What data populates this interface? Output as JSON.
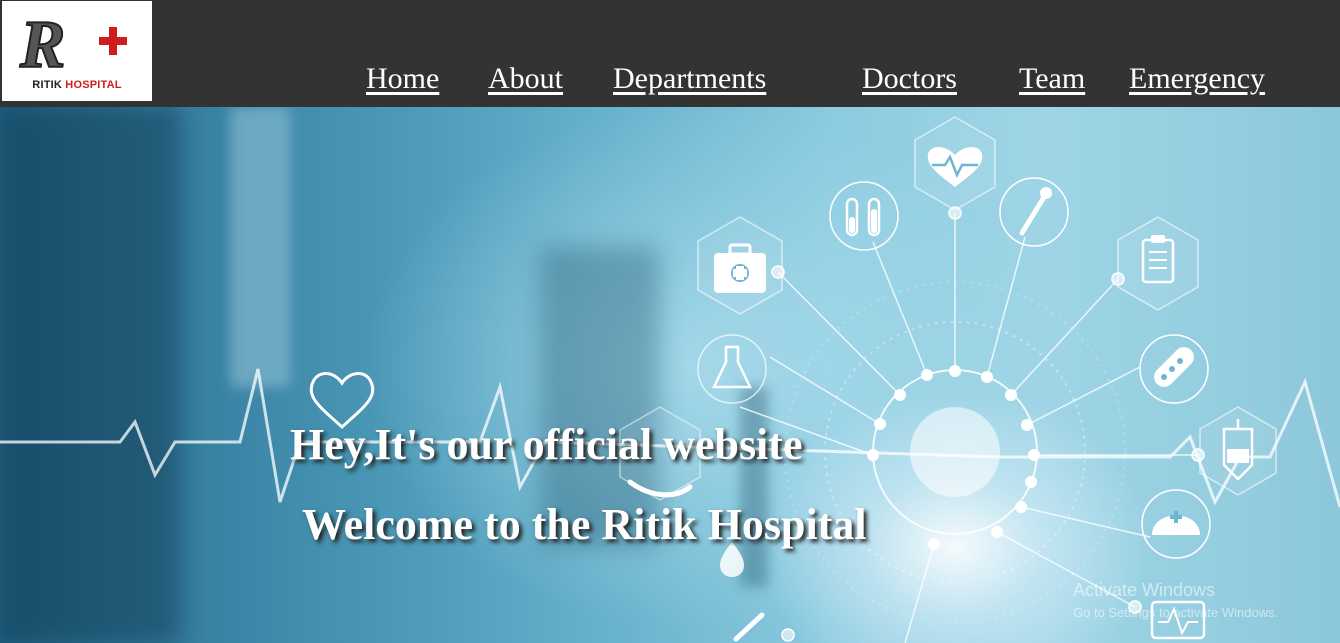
{
  "logo": {
    "initials": "R",
    "name_part1": "RITIK",
    "name_part2": "HOSPITAL"
  },
  "nav": {
    "home": "Home",
    "about": "About",
    "departments": "Departments",
    "doctors": "Doctors",
    "team": "Team",
    "emergency": "Emergency"
  },
  "hero": {
    "line1": "Hey,It's our official website",
    "line2": "Welcome to the Ritik Hospital"
  },
  "watermark": {
    "title": "Activate Windows",
    "subtitle": "Go to Settings to activate Windows."
  },
  "icons": [
    "first-aid-kit-icon",
    "test-tubes-icon",
    "heart-rate-icon",
    "dropper-icon",
    "clipboard-icon",
    "flask-icon",
    "pills-icon",
    "iv-bag-icon",
    "stethoscope-icon",
    "nurse-cap-icon",
    "monitor-icon",
    "syringe-icon"
  ],
  "colors": {
    "navbar": "#333333",
    "logo_red": "#d01c1c",
    "nav_text": "#ffffff"
  }
}
